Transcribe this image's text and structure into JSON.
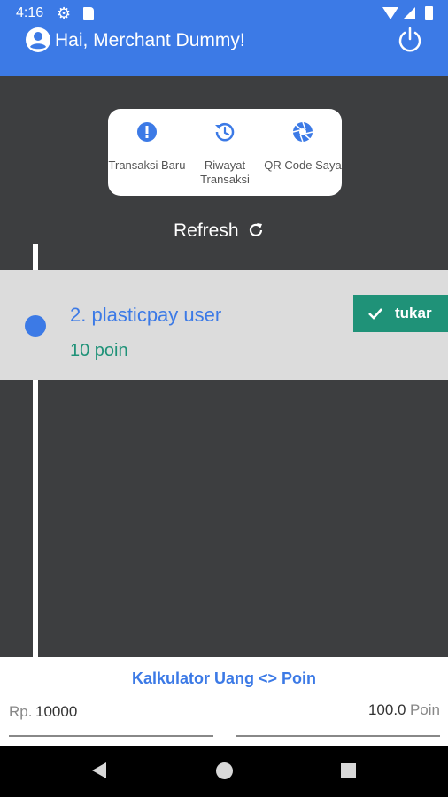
{
  "status_bar": {
    "time": "4:16"
  },
  "header": {
    "greeting": "Hai, Merchant Dummy!",
    "icons": [
      "account-circle-icon",
      "power-icon"
    ]
  },
  "menu": {
    "items": [
      {
        "label": "Transaksi Baru",
        "icon": "alert-badge-icon"
      },
      {
        "label": "Riwayat Transaksi",
        "icon": "history-icon"
      },
      {
        "label": "QR Code Saya",
        "icon": "camera-aperture-icon"
      }
    ]
  },
  "refresh": {
    "label": "Refresh"
  },
  "transactions": [
    {
      "title": "2. plasticpay user",
      "points": "10 poin",
      "action_label": "tukar"
    }
  ],
  "calculator": {
    "title": "Kalkulator Uang <> Poin",
    "money_prefix": "Rp.",
    "money_value": "10000",
    "points_value": "100.0",
    "points_suffix": "Poin"
  },
  "colors": {
    "primary": "#3c7ae6",
    "accent": "#1f9278",
    "background": "#3d3e40"
  }
}
